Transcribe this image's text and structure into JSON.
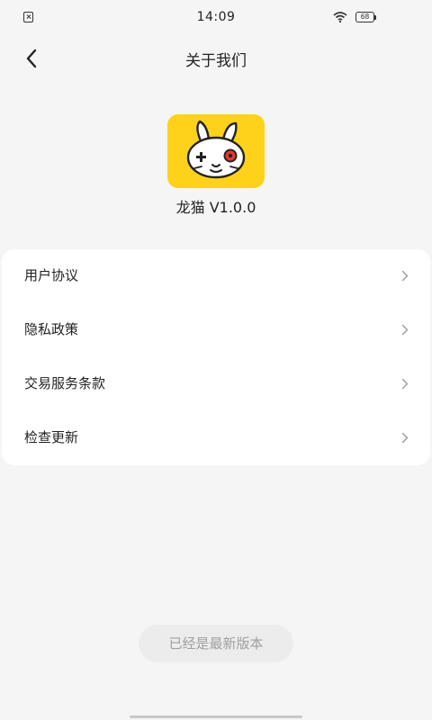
{
  "status_bar": {
    "time": "14:09",
    "battery_level": "68",
    "icons": [
      "notification-icon",
      "wifi-icon",
      "battery-icon"
    ]
  },
  "nav": {
    "title": "关于我们",
    "back_icon": "chevron-left-icon"
  },
  "app": {
    "logo_icon": "rabbit-gamepad-logo",
    "version_text": "龙猫 V1.0.0"
  },
  "menu": {
    "items": [
      {
        "label": "用户协议"
      },
      {
        "label": "隐私政策"
      },
      {
        "label": "交易服务条款"
      },
      {
        "label": "检查更新"
      }
    ]
  },
  "toast": {
    "text": "已经是最新版本"
  },
  "colors": {
    "background": "#f5f5f5",
    "card": "#ffffff",
    "logo_bg": "#fed21a",
    "toast_bg": "#ececec",
    "toast_text": "#a0a0a0"
  }
}
